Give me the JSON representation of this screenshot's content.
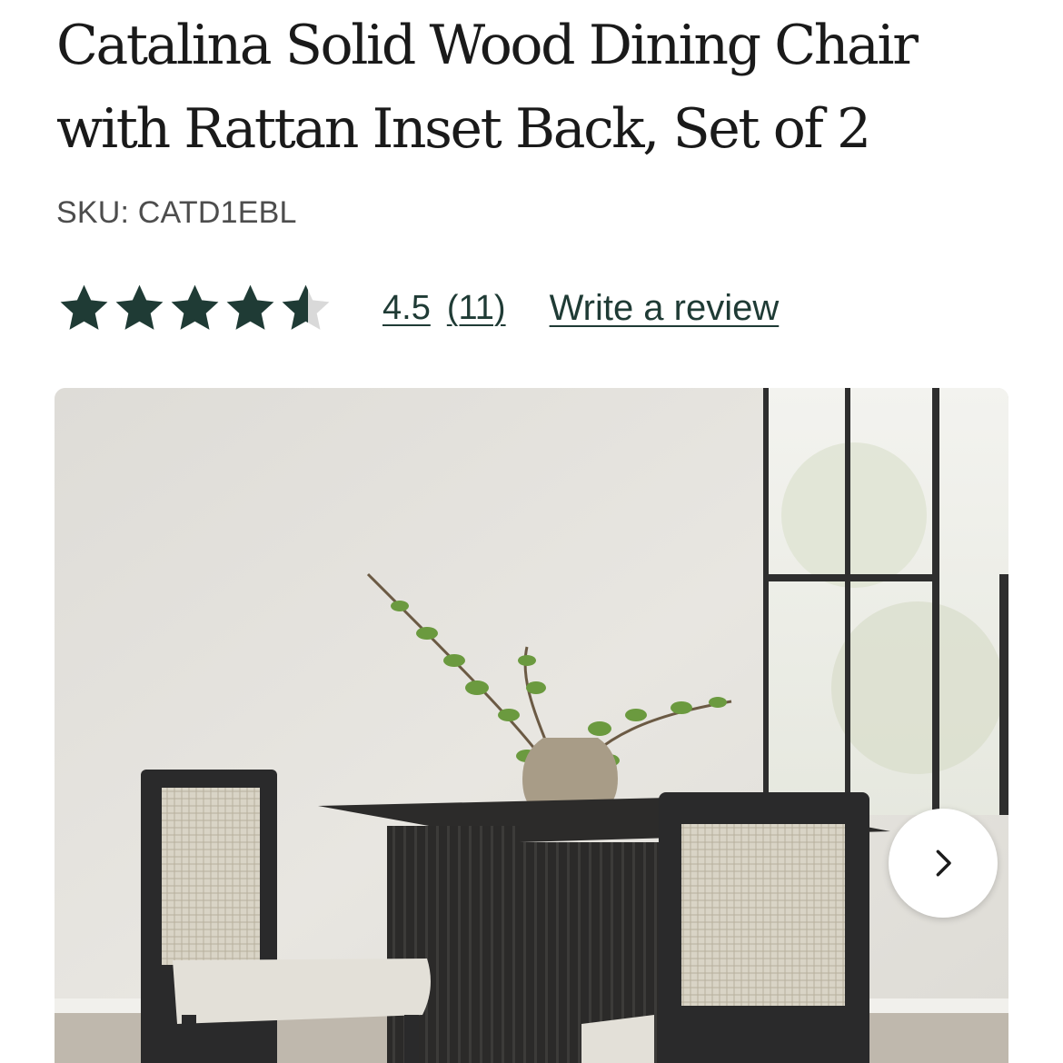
{
  "product": {
    "title": "Catalina Solid Wood Dining Chair with Rattan Inset Back, Set of 2",
    "sku": "SKU: CATD1EBL"
  },
  "rating": {
    "value": "4.5",
    "count": "(11)",
    "stars_filled": 4.5,
    "stars_total": 5,
    "star_color": "#1f3b35",
    "write_review_label": "Write a review"
  },
  "gallery": {
    "image_alt": "Catalina dining chairs with rattan inset backs at a black fluted table with a vase of greenery",
    "next_icon": "chevron-right-icon"
  }
}
